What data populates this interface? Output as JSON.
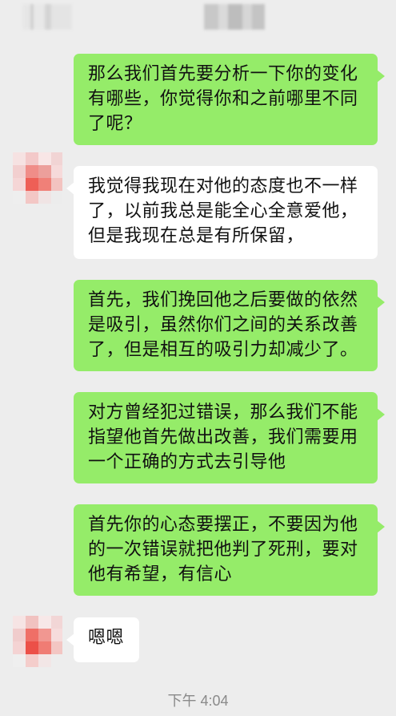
{
  "messages": [
    {
      "side": "right",
      "text": "那么我们首先要分析一下你的变化有哪些，你觉得你和之前哪里不同了呢？"
    },
    {
      "side": "left",
      "text": "我觉得我现在对他的态度也不一样了，以前我总是能全心全意爱他，但是我现在总是有所保留，"
    },
    {
      "side": "right",
      "text": "首先，我们挽回他之后要做的依然是吸引，虽然你们之间的关系改善了，但是相互的吸引力却减少了。"
    },
    {
      "side": "right",
      "text": "对方曾经犯过错误，那么我们不能指望他首先做出改善，我们需要用一个正确的方式去引导他"
    },
    {
      "side": "right",
      "text": "首先你的心态要摆正，不要因为他的一次错误就把他判了死刑，要对他有希望，有信心"
    },
    {
      "side": "left",
      "text": "嗯嗯"
    }
  ],
  "timestamp": "下午 4:04",
  "colors": {
    "background": "#ededed",
    "sent_bubble": "#95ec69",
    "received_bubble": "#ffffff"
  }
}
